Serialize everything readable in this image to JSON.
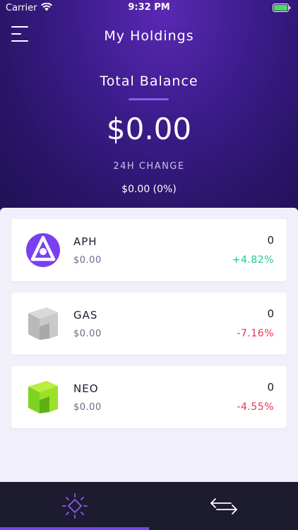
{
  "status_bar": {
    "carrier": "Carrier",
    "time": "9:32 PM"
  },
  "header": {
    "title": "My Holdings",
    "total_label": "Total Balance",
    "total_amount": "$0.00",
    "change_label": "24H CHANGE",
    "change_value": "$0.00 (0%)"
  },
  "holdings": [
    {
      "symbol": "APH",
      "value": "$0.00",
      "quantity": "0",
      "change": "+4.82%",
      "change_color": "#1fc98e",
      "icon": "aphelion-logo-icon"
    },
    {
      "symbol": "GAS",
      "value": "$0.00",
      "quantity": "0",
      "change": "-7.16%",
      "change_color": "#e8315a",
      "icon": "gas-logo-icon"
    },
    {
      "symbol": "NEO",
      "value": "$0.00",
      "quantity": "0",
      "change": "-4.55%",
      "change_color": "#e8315a",
      "icon": "neo-logo-icon"
    }
  ],
  "bottom_nav": {
    "tabs": [
      {
        "icon": "holdings-diamond-icon",
        "active": true
      },
      {
        "icon": "transfer-arrows-icon",
        "active": false
      }
    ]
  },
  "colors": {
    "accent": "#7b3ff2",
    "positive": "#1fc98e",
    "negative": "#e8315a"
  }
}
